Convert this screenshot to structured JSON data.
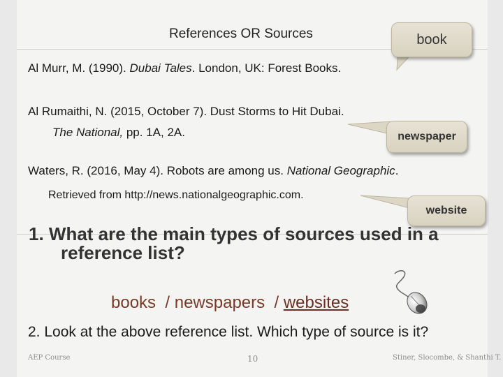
{
  "slide": {
    "title": "References OR Sources",
    "references": [
      {
        "author": "Al Murr, M. (1990). ",
        "title_italic": "Dubai Tales",
        "rest": ". London, UK: Forest Books."
      },
      {
        "line1": "Al Rumaithi, N. (2015, October 7). Dust Storms to Hit Dubai.",
        "line2_italic": "The National,",
        "line2_rest": " pp. 1A, 2A."
      },
      {
        "line1_start": "Waters, R. (2016, May 4). Robots are among us. ",
        "line1_italic": "National Geographic",
        "line1_end": ".",
        "line2": "Retrieved from http://news.nationalgeographic.com."
      }
    ],
    "callouts": {
      "book": "book",
      "newspaper": "newspaper",
      "website": "website"
    },
    "question1": {
      "line1": "1.  What are the main types of sources used in a",
      "line2": "reference list?"
    },
    "answers": {
      "books": "books",
      "sep1": "  / newspapers  / ",
      "websites": "websites"
    },
    "question2": "2.  Look at the above reference list. Which type of source is it?",
    "footer": {
      "left": "AEP Course",
      "page": "10",
      "right": "Stiner, Slocombe, & Shanthi T."
    },
    "icons": {
      "mouse": "computer-mouse-icon"
    }
  }
}
